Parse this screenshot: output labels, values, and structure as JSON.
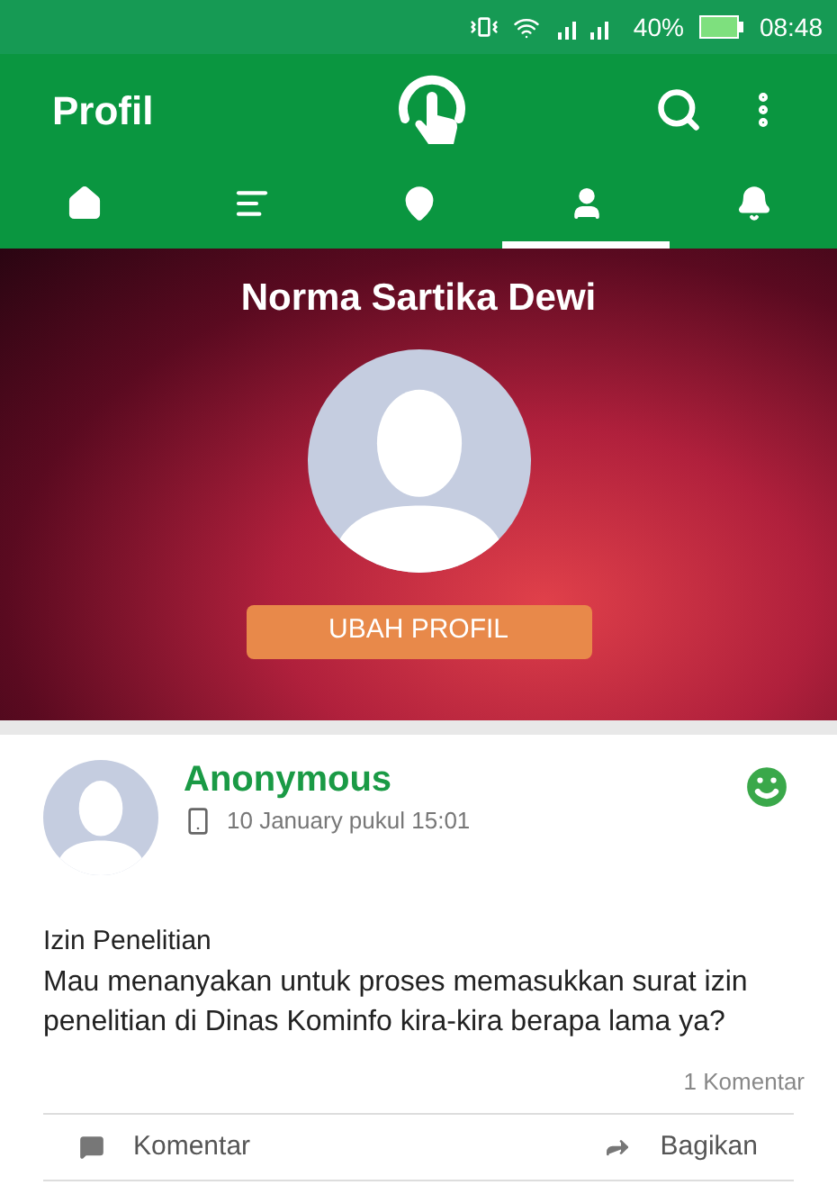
{
  "status_bar": {
    "battery": "40%",
    "time": "08:48"
  },
  "app_bar": {
    "title": "Profil"
  },
  "tabs": [
    {
      "kind": "home",
      "selected": false
    },
    {
      "kind": "list",
      "selected": false
    },
    {
      "kind": "location",
      "selected": false
    },
    {
      "kind": "profile",
      "selected": true
    },
    {
      "kind": "notifications",
      "selected": false
    }
  ],
  "profile": {
    "name": "Norma Sartika Dewi",
    "button": "UBAH PROFIL"
  },
  "post": {
    "author": "Anonymous",
    "date": "10 January pukul 15:01",
    "title": "Izin Penelitian",
    "body": "Mau menanyakan untuk proses memasukkan surat izin penelitian di Dinas Kominfo kira-kira berapa lama ya?",
    "comment_count": "1 Komentar",
    "actions": [
      {
        "kind": "comment",
        "label": "Komentar"
      },
      {
        "kind": "share",
        "label": "Bagikan"
      }
    ]
  }
}
